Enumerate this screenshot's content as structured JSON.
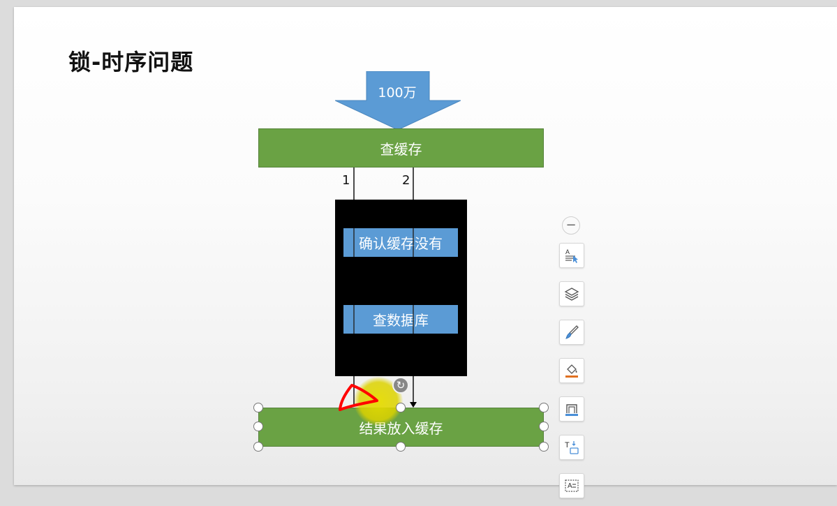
{
  "slide": {
    "title": "锁-时序问题"
  },
  "diagram": {
    "arrow_label": "100万",
    "query_cache_label": "查缓存",
    "thread_1_label": "1",
    "thread_2_label": "2",
    "confirm_cache_label": "确认缓存没有",
    "query_db_label": "查数据库",
    "result_cache_label": "结果放入缓存"
  },
  "toolbar": {
    "collapse_glyph": "−",
    "buttons": [
      {
        "icon": "text-select-icon"
      },
      {
        "icon": "layers-icon"
      },
      {
        "icon": "brush-icon"
      },
      {
        "icon": "fill-bucket-icon"
      },
      {
        "icon": "shape-outline-icon"
      },
      {
        "icon": "text-wrap-icon"
      },
      {
        "icon": "text-box-icon"
      }
    ]
  },
  "colors": {
    "green": "#6aa244",
    "blue": "#5b9bd5",
    "highlight": "#e6dc00",
    "annotation": "#ff0000"
  }
}
